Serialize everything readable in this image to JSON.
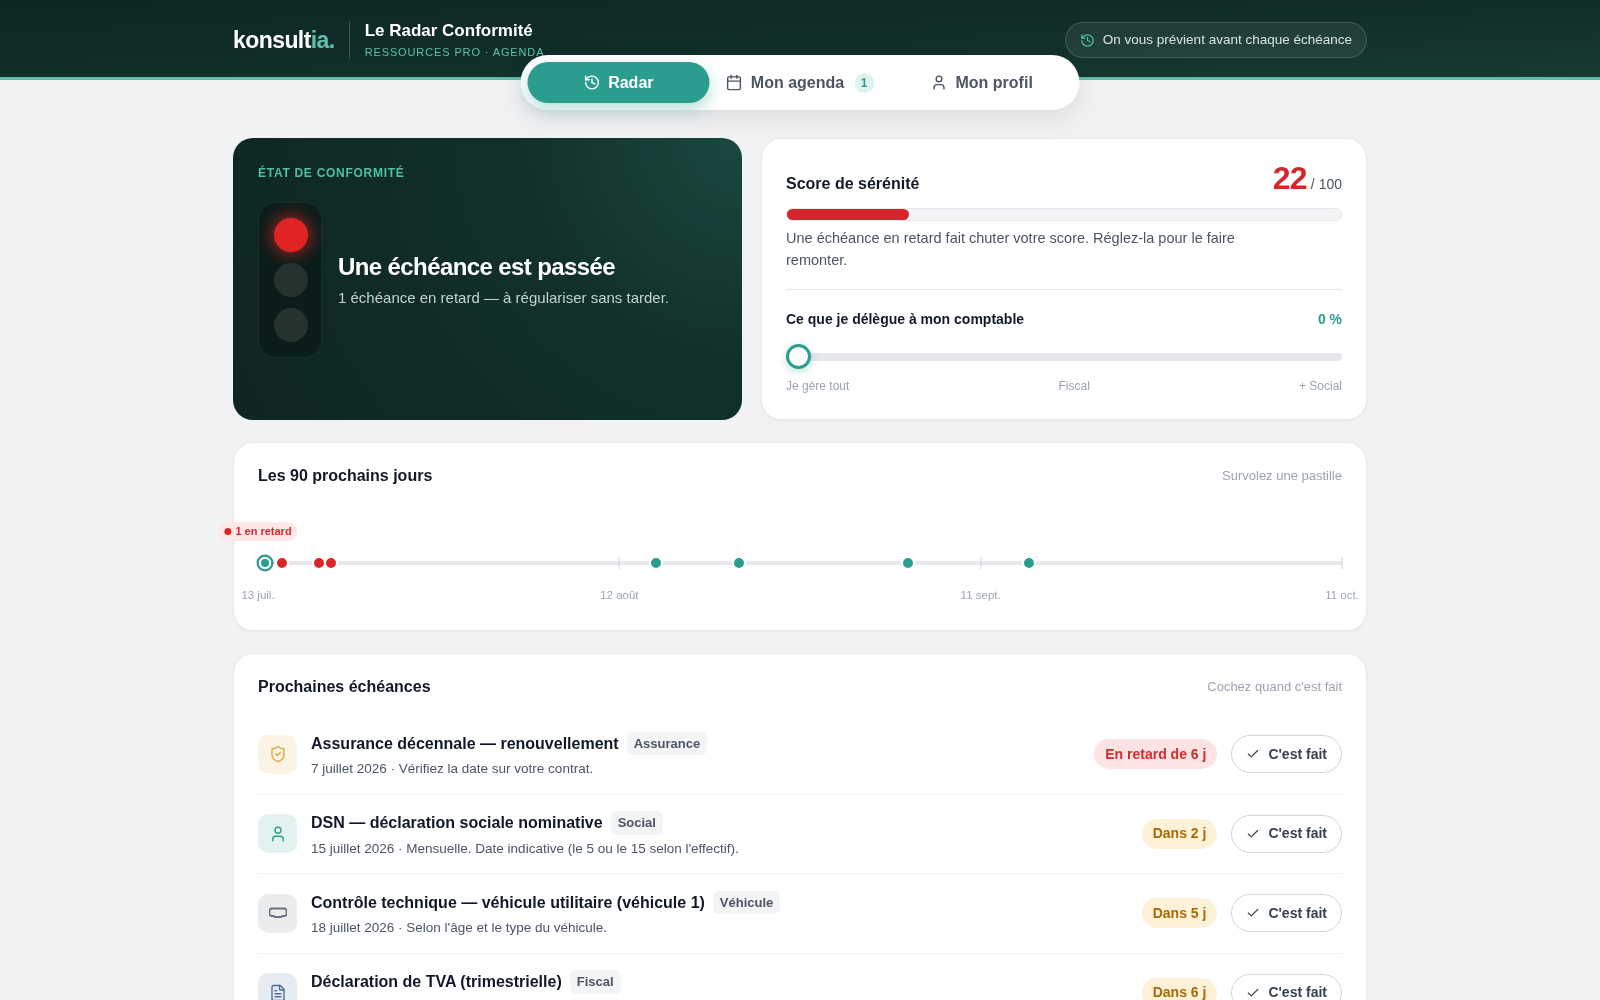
{
  "header": {
    "logo": {
      "main": "konsult",
      "accent": "ia."
    },
    "title": "Le Radar Conformité",
    "subtitle": "RESSOURCES PRO · AGENDA",
    "notice": "On vous prévient avant chaque échéance"
  },
  "tabs": [
    {
      "kind": "radar",
      "label": "Radar",
      "selected": true
    },
    {
      "kind": "agenda",
      "label": "Mon agenda",
      "badge": "1",
      "selected": false
    },
    {
      "kind": "profile",
      "label": "Mon profil",
      "selected": false
    }
  ],
  "status_card": {
    "eyebrow": "ÉTAT DE CONFORMITÉ",
    "lamps": [
      {
        "on": true
      },
      {
        "on": false
      },
      {
        "on": false
      }
    ],
    "headline": "Une échéance est passée",
    "detail": "1 échéance en retard — à régulariser sans tarder."
  },
  "score_card": {
    "title": "Score de sérénité",
    "score": "22",
    "max": "/ 100",
    "level": 0.22,
    "note": "Une échéance en retard fait chuter votre score. Réglez-la pour le faire remonter.",
    "delegation": {
      "label": "Ce que je délègue à mon comptable",
      "reading": "0 %",
      "level": 0,
      "stops": [
        "Je gère tout",
        "Fiscal",
        "+ Social"
      ]
    }
  },
  "timeline": {
    "title": "Les 90 prochains jours",
    "hint": "Survolez une pastille",
    "overdue_tag": "1 en retard",
    "markers": [
      {
        "kind": "today",
        "color": "#2a9d8f",
        "level": 0.006
      },
      {
        "kind": "dot",
        "color": "#dc2626",
        "level": 0.022
      },
      {
        "kind": "dot",
        "color": "#dc2626",
        "level": 0.056
      },
      {
        "kind": "dot",
        "color": "#dc2626",
        "level": 0.067
      },
      {
        "kind": "dot",
        "color": "#2a9d8f",
        "level": 0.367
      },
      {
        "kind": "dot",
        "color": "#2a9d8f",
        "level": 0.444
      },
      {
        "kind": "dot",
        "color": "#2a9d8f",
        "level": 0.6
      },
      {
        "kind": "dot",
        "color": "#2a9d8f",
        "level": 0.711
      }
    ],
    "ticks": [
      "13 juil.",
      "12 août",
      "11 sept.",
      "11 oct."
    ]
  },
  "deadlines": {
    "title": "Prochaines échéances",
    "hint": "Cochez quand c'est fait",
    "items": [
      {
        "kind": "insurance",
        "color": "#e3a33b",
        "title": "Assurance décennale — renouvellement",
        "tag": "Assurance",
        "detail": "7 juillet 2026 · Vérifiez la date sur votre contrat.",
        "status": {
          "kind": "overdue",
          "text": "En retard de 6 j"
        },
        "action": "C'est fait"
      },
      {
        "kind": "social",
        "color": "#2a9d8f",
        "title": "DSN — déclaration sociale nominative",
        "tag": "Social",
        "detail": "15 juillet 2026 · Mensuelle. Date indicative (le 5 ou le 15 selon l'effectif).",
        "status": {
          "kind": "soon",
          "text": "Dans 2 j"
        },
        "action": "C'est fait"
      },
      {
        "kind": "vehicle",
        "color": "#6b7280",
        "title": "Contrôle technique — véhicule utilitaire (véhicule 1)",
        "tag": "Véhicule",
        "detail": "18 juillet 2026 · Selon l'âge et le type du véhicule.",
        "status": {
          "kind": "soon",
          "text": "Dans 5 j"
        },
        "action": "C'est fait"
      },
      {
        "kind": "tax",
        "color": "#4a6a9c",
        "title": "Déclaration de TVA (trimestrielle)",
        "tag": "Fiscal",
        "status": {
          "kind": "soon",
          "text": "Dans 6 j"
        },
        "action": "C'est fait"
      }
    ]
  }
}
